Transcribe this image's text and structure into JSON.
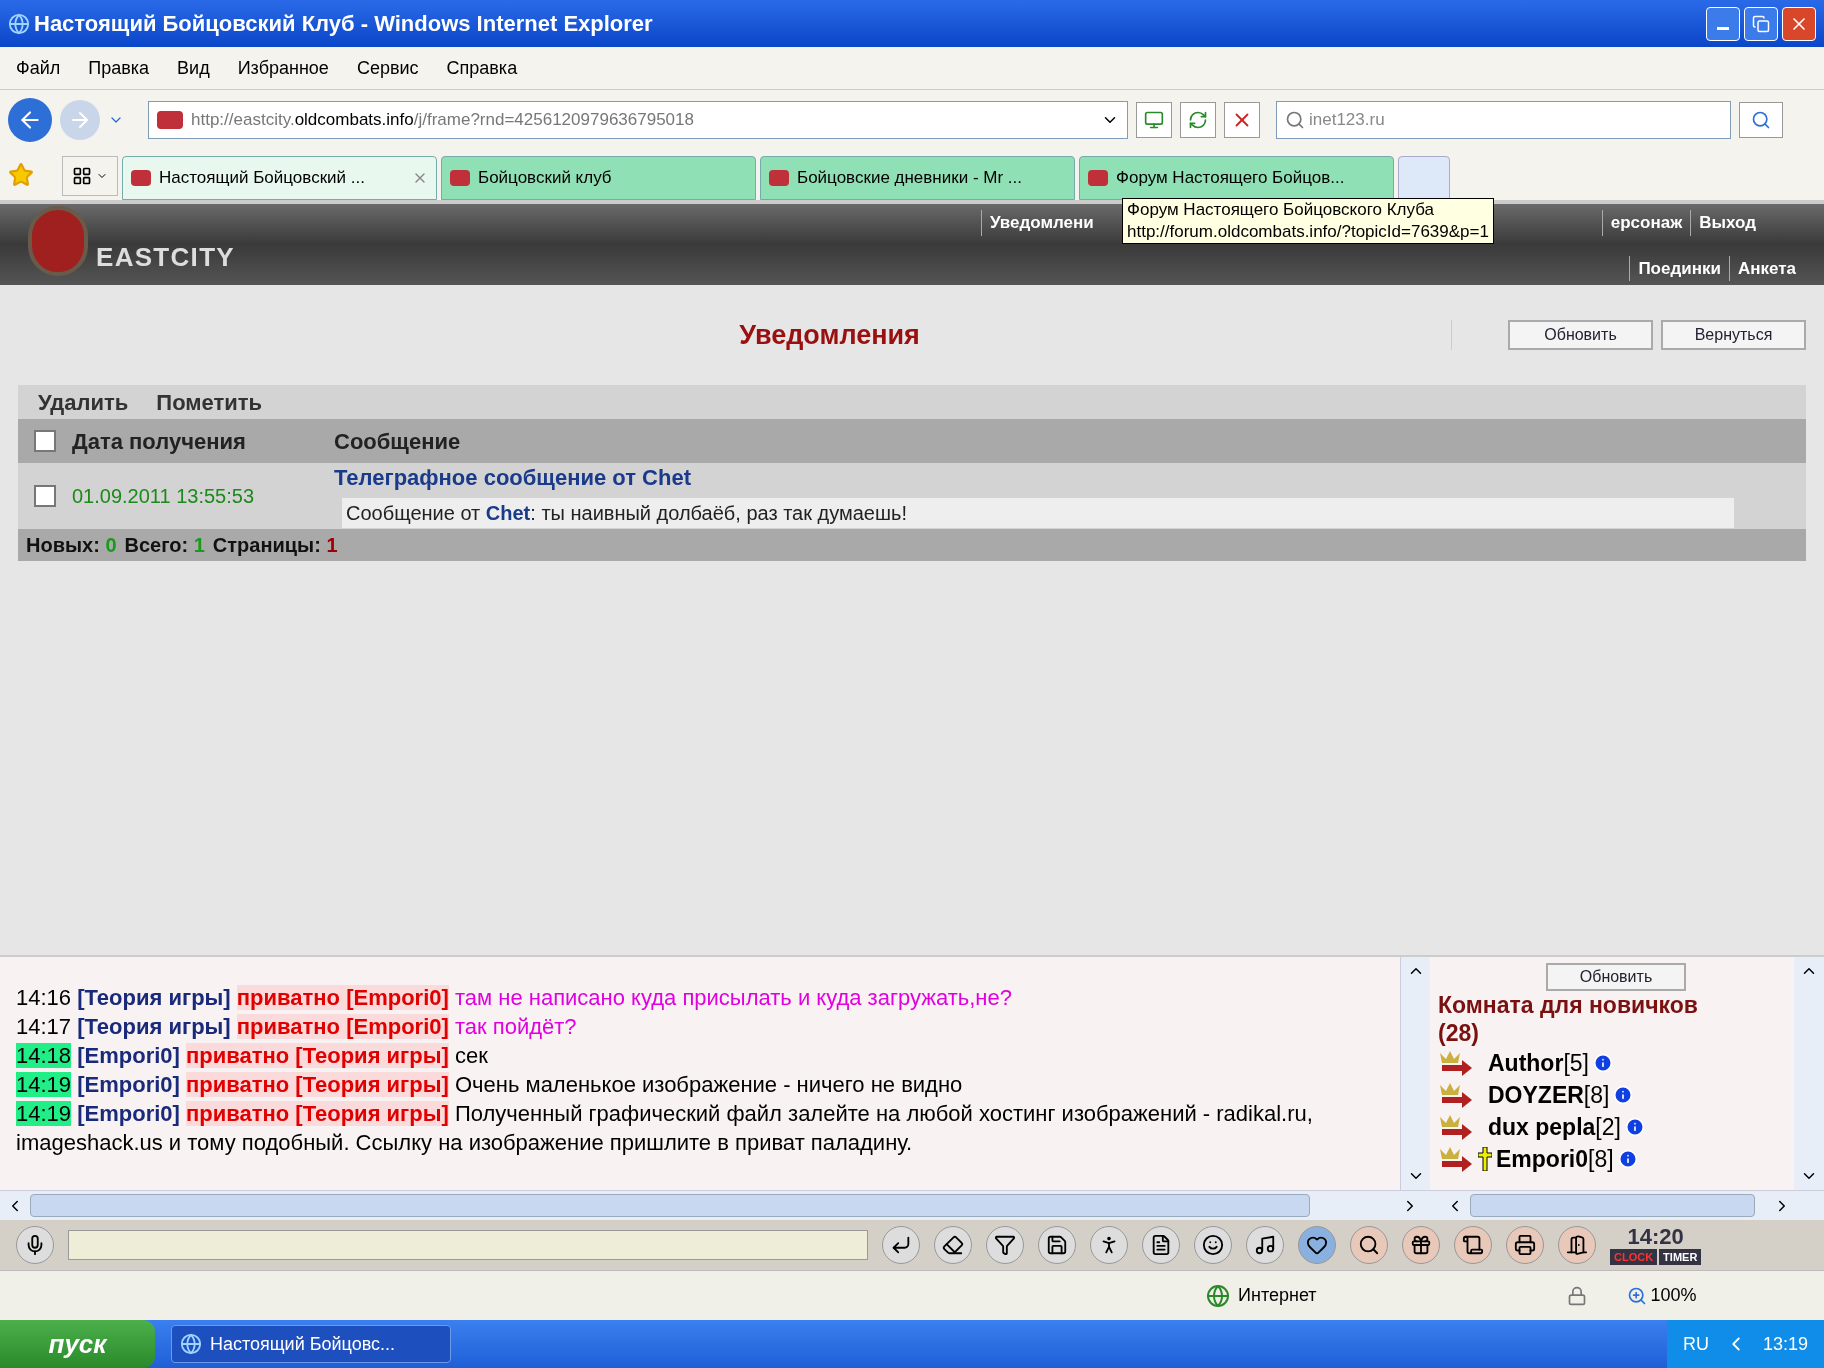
{
  "window": {
    "title": "Настоящий Бойцовский Клуб - Windows Internet Explorer"
  },
  "menu": [
    "Файл",
    "Правка",
    "Вид",
    "Избранное",
    "Сервис",
    "Справка"
  ],
  "address": {
    "prefix": "http://eastcity.",
    "domain": "oldcombats.info",
    "suffix": "/j/frame?rnd=4256120979636795018"
  },
  "search": {
    "placeholder": "inet123.ru"
  },
  "tabs": [
    {
      "label": "Настоящий Бойцовский ...",
      "selected": true,
      "closable": true
    },
    {
      "label": "Бойцовский клуб",
      "selected": false,
      "closable": false
    },
    {
      "label": "Бойцовские дневники - Mr ...",
      "selected": false,
      "closable": false
    },
    {
      "label": "Форум Настоящего Бойцов...",
      "selected": false,
      "closable": false
    }
  ],
  "game_header": {
    "logo": "EASTCITY",
    "top_links": [
      "Уведомлени",
      "ерсонаж",
      "Выход"
    ],
    "bottom_links": [
      "Поединки",
      "Анкета"
    ]
  },
  "tooltip": {
    "title": "Форум Настоящего Бойцовского Клуба",
    "url": "http://forum.oldcombats.info/?topicId=7639&p=1"
  },
  "notifications": {
    "title": "Уведомления",
    "buttons": [
      "Обновить",
      "Вернуться"
    ],
    "actions": [
      "Удалить",
      "Пометить"
    ],
    "header_checked": false,
    "columns": [
      "Дата получения",
      "Сообщение"
    ],
    "rows": [
      {
        "checked": false,
        "date": "01.09.2011 13:55:53",
        "subject": "Телеграфное сообщение от Chet",
        "text_before": "Сообщение от",
        "sender": "Chet",
        "text_after": ": ты наивный долбаёб, раз так думаешь!"
      }
    ],
    "footer": [
      {
        "label": "Новых:",
        "value": "0",
        "color": "#1a9a1a"
      },
      {
        "label": "Всего:",
        "value": "1",
        "color": "#1a9a1a"
      },
      {
        "label": "Страницы:",
        "value": "1",
        "color": "#a00000"
      }
    ]
  },
  "chat": [
    {
      "time": "14:16",
      "highlight": false,
      "author": "[Теория игры]",
      "private": "приватно [Empori0]",
      "text": "там не написано куда присылать и куда загружать,не?",
      "color": "#e000e0"
    },
    {
      "time": "14:17",
      "highlight": false,
      "author": "[Теория игры]",
      "private": "приватно [Empori0]",
      "text": "так пойдёт?",
      "color": "#e000e0"
    },
    {
      "time": "14:18",
      "highlight": true,
      "author": "[Empori0]",
      "private": "приватно [Теория игры]",
      "text": "сек",
      "color": "#000000"
    },
    {
      "time": "14:19",
      "highlight": true,
      "author": "[Empori0]",
      "private": "приватно [Теория игры]",
      "text": "Очень маленькое изображение - ничего не видно",
      "color": "#000000"
    },
    {
      "time": "14:19",
      "highlight": true,
      "author": "[Empori0]",
      "private": "приватно [Теория игры]",
      "text": "Полученный графический файл залейте на любой хостинг изображений - radikal.ru, imageshack.us и тому подобный. Ссылку на изображение пришлите в приват паладину.",
      "color": "#000000"
    }
  ],
  "room": {
    "button": "Обновить",
    "title": "Комната для новичков (28)",
    "users": [
      {
        "name": "Author",
        "level": "[5]",
        "cross": false
      },
      {
        "name": "DOYZER",
        "level": "[8]",
        "cross": false
      },
      {
        "name": "dux pepla",
        "level": "[2]",
        "cross": false
      },
      {
        "name": "Empori0",
        "level": "[8]",
        "cross": true
      }
    ]
  },
  "clock": {
    "time": "14:20",
    "labels": [
      "CLOCK",
      "TIMER"
    ]
  },
  "status_bar": {
    "zone": "Интернет",
    "zoom": "100%"
  },
  "taskbar": {
    "start": "пуск",
    "window": "Настоящий Бойцовс...",
    "lang": "RU",
    "time": "13:19"
  }
}
